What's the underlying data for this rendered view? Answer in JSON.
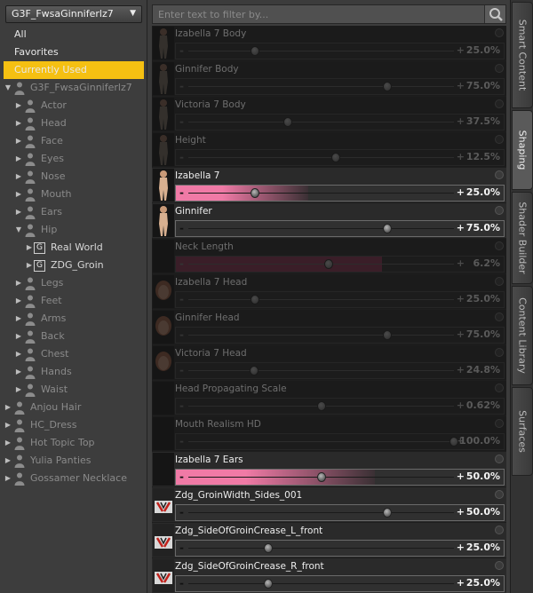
{
  "figure_selector": {
    "value": "G3F_FwsaGinniferlz7"
  },
  "tree": [
    {
      "label": "All",
      "kind": "top"
    },
    {
      "label": "Favorites",
      "kind": "top"
    },
    {
      "label": "Currently Used",
      "kind": "selected"
    },
    {
      "label": "G3F_FwsaGinniferlz7",
      "kind": "root",
      "twist": "down"
    },
    {
      "label": "Actor",
      "kind": "child",
      "twist": "right"
    },
    {
      "label": "Head",
      "kind": "child",
      "twist": "right"
    },
    {
      "label": "Face",
      "kind": "child",
      "twist": "right"
    },
    {
      "label": "Eyes",
      "kind": "child",
      "twist": "right"
    },
    {
      "label": "Nose",
      "kind": "child",
      "twist": "right"
    },
    {
      "label": "Mouth",
      "kind": "child",
      "twist": "right"
    },
    {
      "label": "Ears",
      "kind": "child",
      "twist": "right"
    },
    {
      "label": "Hip",
      "kind": "child",
      "twist": "down"
    },
    {
      "label": "Real World",
      "kind": "group"
    },
    {
      "label": "ZDG_Groin",
      "kind": "group"
    },
    {
      "label": "Legs",
      "kind": "child",
      "twist": "right"
    },
    {
      "label": "Feet",
      "kind": "child",
      "twist": "right"
    },
    {
      "label": "Arms",
      "kind": "child",
      "twist": "right"
    },
    {
      "label": "Back",
      "kind": "child",
      "twist": "right"
    },
    {
      "label": "Chest",
      "kind": "child",
      "twist": "right"
    },
    {
      "label": "Hands",
      "kind": "child",
      "twist": "right"
    },
    {
      "label": "Waist",
      "kind": "child",
      "twist": "right"
    },
    {
      "label": "Anjou Hair",
      "kind": "root",
      "twist": "right"
    },
    {
      "label": "HC_Dress",
      "kind": "root",
      "twist": "right"
    },
    {
      "label": "Hot Topic Top",
      "kind": "root",
      "twist": "right"
    },
    {
      "label": "Yulia Panties",
      "kind": "root",
      "twist": "right"
    },
    {
      "label": "Gossamer Necklace",
      "kind": "root",
      "twist": "right"
    }
  ],
  "search": {
    "placeholder": "Enter text to filter by..."
  },
  "sliders": [
    {
      "name": "Izabella 7 Body",
      "value": "25.0%",
      "pos": 0.25,
      "enabled": false,
      "thumb": "body"
    },
    {
      "name": "Ginnifer Body",
      "value": "75.0%",
      "pos": 0.75,
      "enabled": false,
      "thumb": "body"
    },
    {
      "name": "Victoria 7 Body",
      "value": "37.5%",
      "pos": 0.375,
      "enabled": false,
      "thumb": "body"
    },
    {
      "name": "Height",
      "value": "12.5%",
      "pos": 0.555,
      "enabled": false,
      "thumb": "body"
    },
    {
      "name": "Izabella 7",
      "value": "25.0%",
      "pos": 0.25,
      "enabled": true,
      "thumb": "body",
      "fill": "#f07aa6"
    },
    {
      "name": "Ginnifer",
      "value": "75.0%",
      "pos": 0.75,
      "enabled": true,
      "thumb": "body"
    },
    {
      "name": "Neck Length",
      "value": "6.2%",
      "pos": 0.53,
      "enabled": false,
      "thumb": "none",
      "fill": "#3a1e28"
    },
    {
      "name": "Izabella 7 Head",
      "value": "25.0%",
      "pos": 0.25,
      "enabled": false,
      "thumb": "head"
    },
    {
      "name": "Ginnifer Head",
      "value": "75.0%",
      "pos": 0.75,
      "enabled": false,
      "thumb": "head"
    },
    {
      "name": "Victoria 7 Head",
      "value": "24.8%",
      "pos": 0.248,
      "enabled": false,
      "thumb": "head"
    },
    {
      "name": "Head Propagating Scale",
      "value": "0.62%",
      "pos": 0.5,
      "enabled": false,
      "thumb": "none"
    },
    {
      "name": "Mouth Realism HD",
      "value": "100.0%",
      "pos": 1.0,
      "enabled": false,
      "thumb": "none"
    },
    {
      "name": "Izabella 7 Ears",
      "value": "50.0%",
      "pos": 0.5,
      "enabled": true,
      "thumb": "none",
      "fill": "#f07aa6"
    },
    {
      "name": "Zdg_GroinWidth_Sides_001",
      "value": "50.0%",
      "pos": 0.75,
      "enabled": true,
      "thumb": "icon"
    },
    {
      "name": "Zdg_SideOfGroinCrease_L_front",
      "value": "25.0%",
      "pos": 0.3,
      "enabled": true,
      "thumb": "icon"
    },
    {
      "name": "Zdg_SideOfGroinCrease_R_front",
      "value": "25.0%",
      "pos": 0.3,
      "enabled": true,
      "thumb": "icon"
    }
  ],
  "tabs": [
    {
      "label": "Smart Content",
      "active": false
    },
    {
      "label": "Shaping",
      "active": true
    },
    {
      "label": "Shader Builder",
      "active": false
    },
    {
      "label": "Content Library",
      "active": false
    },
    {
      "label": "Surfaces",
      "active": false
    }
  ],
  "colors": {
    "accent_selected": "#f5c012",
    "slider_fill": "#f07aa6"
  }
}
